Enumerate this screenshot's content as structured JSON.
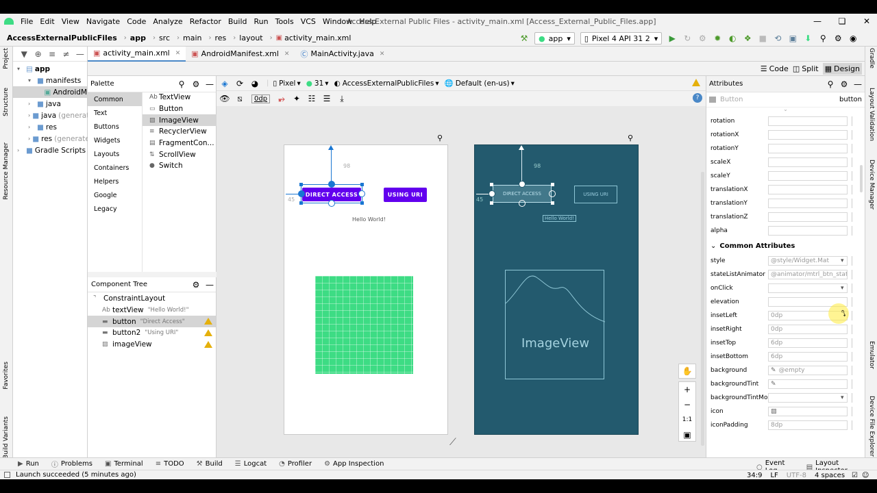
{
  "menu": [
    "File",
    "Edit",
    "View",
    "Navigate",
    "Code",
    "Analyze",
    "Refactor",
    "Build",
    "Run",
    "Tools",
    "VCS",
    "Window",
    "Help"
  ],
  "window_title": "Access External Public Files - activity_main.xml [Access_External_Public_Files.app]",
  "breadcrumb": [
    "AccessExternalPublicFiles",
    "app",
    "src",
    "main",
    "res",
    "layout",
    "activity_main.xml"
  ],
  "run_config": "app",
  "device_config": "Pixel 4 API 31 2",
  "left_strip": [
    "Project",
    "Structure",
    "Resource Manager",
    "Favorites",
    "Build Variants"
  ],
  "right_strip": [
    "Gradle",
    "Layout Validation",
    "Device Manager",
    "Emulator",
    "Device File Explorer"
  ],
  "project_tree": [
    {
      "label": "app",
      "indent": 0,
      "bold": true,
      "expanded": true
    },
    {
      "label": "manifests",
      "indent": 1,
      "expanded": true
    },
    {
      "label": "AndroidM",
      "indent": 2,
      "selected": true
    },
    {
      "label": "java",
      "indent": 1
    },
    {
      "label": "java",
      "suffix": "(generat",
      "indent": 1
    },
    {
      "label": "res",
      "indent": 1
    },
    {
      "label": "res",
      "suffix": "(generate",
      "indent": 1
    },
    {
      "label": "Gradle Scripts",
      "indent": 0
    }
  ],
  "editor_tabs": [
    {
      "label": "activity_main.xml",
      "active": true
    },
    {
      "label": "AndroidManifest.xml",
      "active": false
    },
    {
      "label": "MainActivity.java",
      "active": false
    }
  ],
  "view_modes": {
    "code": "Code",
    "split": "Split",
    "design": "Design"
  },
  "palette": {
    "title": "Palette",
    "categories": [
      "Common",
      "Text",
      "Buttons",
      "Widgets",
      "Layouts",
      "Containers",
      "Helpers",
      "Google",
      "Legacy"
    ],
    "items": [
      {
        "prefix": "Ab",
        "label": "TextView"
      },
      {
        "prefix": "",
        "label": "Button"
      },
      {
        "prefix": "",
        "label": "ImageView"
      },
      {
        "prefix": "",
        "label": "RecyclerView"
      },
      {
        "prefix": "",
        "label": "FragmentCon..."
      },
      {
        "prefix": "",
        "label": "ScrollView"
      },
      {
        "prefix": "",
        "label": "Switch"
      }
    ]
  },
  "design_toolbar": {
    "device": "Pixel",
    "api": "31",
    "theme": "AccessExternalPublicFiles",
    "locale": "Default (en-us)",
    "margin": "0dp"
  },
  "component_tree": {
    "title": "Component Tree",
    "items": [
      {
        "label": "ConstraintLayout",
        "hint": "",
        "indent": 0,
        "warn": false
      },
      {
        "label": "textView",
        "hint": "\"Hello World!\"",
        "indent": 1,
        "warn": false,
        "prefix": "Ab"
      },
      {
        "label": "button",
        "hint": "\"Direct Access\"",
        "indent": 1,
        "warn": true
      },
      {
        "label": "button2",
        "hint": "\"Using URI\"",
        "indent": 1,
        "warn": true
      },
      {
        "label": "imageView",
        "hint": "",
        "indent": 1,
        "warn": true
      }
    ]
  },
  "design_preview": {
    "button1": "DIRECT ACCESS",
    "button2": "USING URI",
    "hello": "Hello World!",
    "margin_top": "98",
    "margin_left": "45"
  },
  "blueprint": {
    "button1": "DIRECT ACCESS",
    "button2": "USING URI",
    "hello": "Hello World!",
    "margin_top": "98",
    "margin_left": "45",
    "image_label": "ImageView"
  },
  "attributes": {
    "title": "Attributes",
    "component_placeholder": "Button",
    "component_id": "button",
    "rows_top": [
      "rotation",
      "rotationX",
      "rotationY",
      "scaleX",
      "scaleY",
      "translationX",
      "translationY",
      "translationZ",
      "alpha"
    ],
    "section": "Common Attributes",
    "rows": [
      {
        "label": "style",
        "value": "@style/Widget.Mat",
        "dropdown": true
      },
      {
        "label": "stateListAnimator",
        "value": "@animator/mtrl_btn_state"
      },
      {
        "label": "onClick",
        "value": "",
        "dropdown": true
      },
      {
        "label": "elevation",
        "value": ""
      },
      {
        "label": "insetLeft",
        "value": "0dp"
      },
      {
        "label": "insetRight",
        "value": "0dp"
      },
      {
        "label": "insetTop",
        "value": "6dp"
      },
      {
        "label": "insetBottom",
        "value": "6dp"
      },
      {
        "label": "background",
        "value": "@empty"
      },
      {
        "label": "backgroundTint",
        "value": ""
      },
      {
        "label": "backgroundTintMo...",
        "value": "",
        "dropdown": true
      },
      {
        "label": "icon",
        "value": ""
      },
      {
        "label": "iconPadding",
        "value": "8dp"
      }
    ]
  },
  "zoom": {
    "fit": "1:1"
  },
  "bottom_tools": [
    "Run",
    "Problems",
    "Terminal",
    "TODO",
    "Build",
    "Logcat",
    "Profiler",
    "App Inspection"
  ],
  "bottom_right_tools": [
    "Event Log",
    "Layout Inspector"
  ],
  "status": {
    "message": "Launch succeeded (5 minutes ago)",
    "position": "34:9",
    "line_sep": "LF",
    "encoding": "UTF-8",
    "indent": "4 spaces"
  },
  "colors": {
    "accent": "#6200ee",
    "blueprint": "#235a6e",
    "imagefill": "#3ddc84",
    "selection": "#1976d2"
  }
}
